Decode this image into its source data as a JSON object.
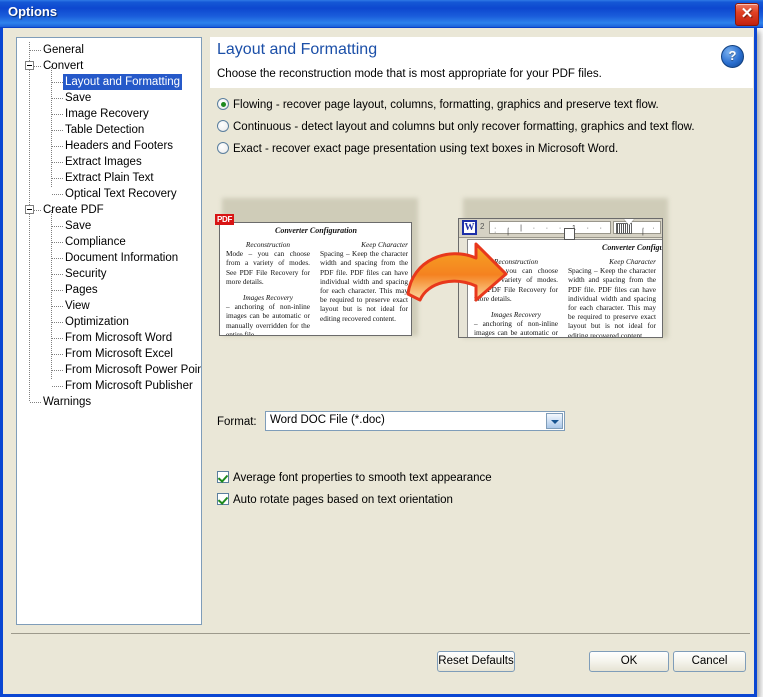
{
  "window": {
    "title": "Options",
    "close_icon": "close-icon"
  },
  "tree": {
    "nodes": [
      {
        "label": "General",
        "depth": 1,
        "expander": false,
        "selected": false
      },
      {
        "label": "Convert",
        "depth": 1,
        "expander": true,
        "selected": false
      },
      {
        "label": "Layout and Formatting",
        "depth": 2,
        "expander": false,
        "selected": true
      },
      {
        "label": "Save",
        "depth": 2,
        "expander": false,
        "selected": false
      },
      {
        "label": "Image Recovery",
        "depth": 2,
        "expander": false,
        "selected": false
      },
      {
        "label": "Table Detection",
        "depth": 2,
        "expander": false,
        "selected": false
      },
      {
        "label": "Headers and Footers",
        "depth": 2,
        "expander": false,
        "selected": false
      },
      {
        "label": "Extract Images",
        "depth": 2,
        "expander": false,
        "selected": false
      },
      {
        "label": "Extract Plain Text",
        "depth": 2,
        "expander": false,
        "selected": false
      },
      {
        "label": "Optical Text Recovery",
        "depth": 2,
        "expander": false,
        "selected": false
      },
      {
        "label": "Create PDF",
        "depth": 1,
        "expander": true,
        "selected": false
      },
      {
        "label": "Save",
        "depth": 2,
        "expander": false,
        "selected": false
      },
      {
        "label": "Compliance",
        "depth": 2,
        "expander": false,
        "selected": false
      },
      {
        "label": "Document Information",
        "depth": 2,
        "expander": false,
        "selected": false
      },
      {
        "label": "Security",
        "depth": 2,
        "expander": false,
        "selected": false
      },
      {
        "label": "Pages",
        "depth": 2,
        "expander": false,
        "selected": false
      },
      {
        "label": "View",
        "depth": 2,
        "expander": false,
        "selected": false
      },
      {
        "label": "Optimization",
        "depth": 2,
        "expander": false,
        "selected": false
      },
      {
        "label": "From Microsoft Word",
        "depth": 2,
        "expander": false,
        "selected": false
      },
      {
        "label": "From Microsoft Excel",
        "depth": 2,
        "expander": false,
        "selected": false
      },
      {
        "label": "From Microsoft Power Point",
        "depth": 2,
        "expander": false,
        "selected": false
      },
      {
        "label": "From Microsoft Publisher",
        "depth": 2,
        "expander": false,
        "selected": false
      },
      {
        "label": "Warnings",
        "depth": 1,
        "expander": false,
        "selected": false
      }
    ]
  },
  "header": {
    "title": "Layout and Formatting",
    "description": "Choose the reconstruction mode that is most appropriate for your PDF files.",
    "help_icon": "help-icon",
    "help_glyph": "?"
  },
  "modes": {
    "selected_index": 0,
    "options": [
      "Flowing - recover page layout, columns, formatting, graphics and preserve text flow.",
      "Continuous - detect layout and columns but only recover formatting, graphics and text flow.",
      "Exact - recover exact page presentation using text boxes in Microsoft Word."
    ]
  },
  "preview": {
    "pdf_badge": "PDF",
    "word_badge": "W",
    "ruler_number": "2",
    "arrow_icon": "curved-right-arrow-icon",
    "doc_heading": "Converter Configuration",
    "pdf_left_column": {
      "p1_head": "Reconstruction",
      "p1_body": "Mode – you can choose from a variety of modes. See PDF File Recovery for more details.",
      "p2_head": "Images Recovery",
      "p2_body": "– anchoring of non-inline images can be automatic or manually overridden for the entire file."
    },
    "pdf_right_column": {
      "p1_head": "Keep Character",
      "p1_body": "Spacing – Keep the character width and spacing from the PDF file. PDF files can have individual width and spacing for each character. This may be required to preserve exact layout but is not ideal for editing recovered content."
    }
  },
  "format": {
    "label": "Format:",
    "value": "Word DOC File (*.doc)",
    "dropdown_icon": "chevron-down-icon"
  },
  "checkboxes": [
    {
      "label": "Average font properties to smooth text appearance",
      "checked": true
    },
    {
      "label": "Auto rotate pages based on text orientation",
      "checked": true
    }
  ],
  "footer": {
    "reset_label": "Reset Defaults",
    "ok_label": "OK",
    "cancel_label": "Cancel"
  },
  "colors": {
    "title_bar": "#0d47cf",
    "dialog_bg": "#eae7d7",
    "heading_blue": "#1b4fa8",
    "selection_blue": "#2659c9",
    "accent_orange": "#f08a1e",
    "pdf_red": "#d81414",
    "word_blue": "#1c2fa8"
  }
}
